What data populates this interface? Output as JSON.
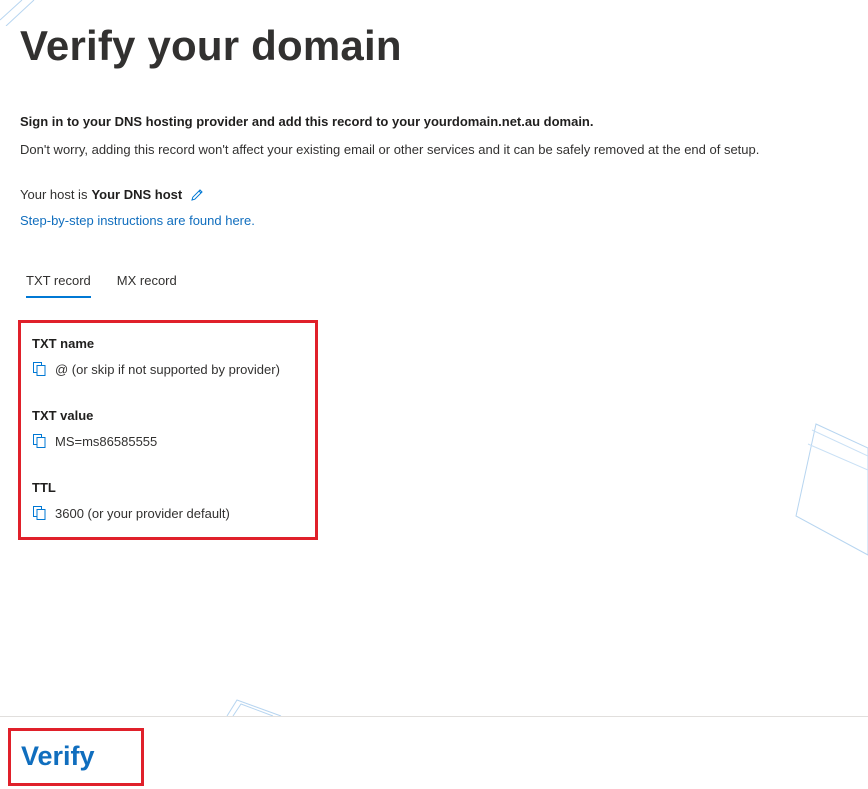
{
  "page": {
    "title": "Verify your domain",
    "instruction": "Sign in to your DNS hosting provider and add this record to your yourdomain.net.au domain.",
    "subtext": "Don't worry, adding this record won't affect your existing email or other services and it can be safely removed at the end of setup.",
    "host_prefix": "Your host is",
    "host_name": "Your DNS host",
    "instructions_link": "Step-by-step instructions are found here."
  },
  "tabs": [
    {
      "label": "TXT record",
      "active": true
    },
    {
      "label": "MX record",
      "active": false
    }
  ],
  "record": {
    "fields": [
      {
        "label": "TXT name",
        "value": "@ (or skip if not supported by provider)"
      },
      {
        "label": "TXT value",
        "value": "MS=ms86585555"
      },
      {
        "label": "TTL",
        "value": "3600 (or your provider default)"
      }
    ]
  },
  "footer": {
    "verify_label": "Verify"
  },
  "colors": {
    "accent": "#106ebe",
    "highlight_border": "#e0202a",
    "text": "#323130"
  },
  "icons": {
    "edit": "pencil-icon",
    "copy": "copy-icon"
  }
}
